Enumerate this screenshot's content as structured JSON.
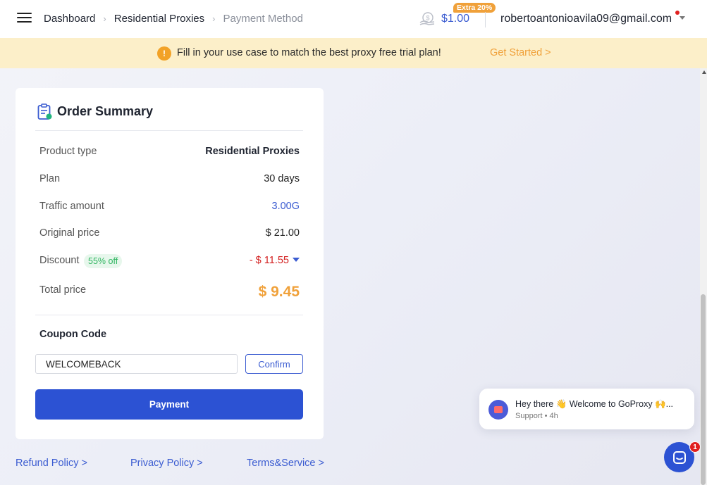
{
  "header": {
    "breadcrumb": [
      "Dashboard",
      "Residential Proxies",
      "Payment Method"
    ],
    "balance": "$1.00",
    "extra_badge": "Extra 20%",
    "user_email": "robertoantonioavila09@gmail.com"
  },
  "banner": {
    "icon_text": "!",
    "text": "Fill in your use case to match the best proxy free trial plan!",
    "link": "Get Started >"
  },
  "order": {
    "title": "Order Summary",
    "rows": [
      {
        "label": "Product type",
        "value": "Residential Proxies"
      },
      {
        "label": "Plan",
        "value": "30 days"
      },
      {
        "label": "Traffic amount",
        "value": "3.00G"
      },
      {
        "label": "Original price",
        "value": "$ 21.00"
      },
      {
        "label": "Discount",
        "value": "- $ 11.55",
        "badge": "55% off"
      },
      {
        "label": "Total price",
        "value": "$ 9.45"
      }
    ],
    "coupon_title": "Coupon Code",
    "coupon_value": "WELCOMEBACK",
    "confirm_label": "Confirm",
    "payment_label": "Payment"
  },
  "footer": {
    "links": [
      "Refund Policy >",
      "Privacy Policy >",
      "Terms&Service >"
    ]
  },
  "chat": {
    "message": "Hey there 👋 Welcome to GoProxy 🙌...",
    "meta": "Support • 4h",
    "badge_count": "1"
  },
  "colors": {
    "accent": "#2c52d3",
    "price": "#f0a13a",
    "discount": "#d32020",
    "banner_bg": "#fcefc9"
  }
}
